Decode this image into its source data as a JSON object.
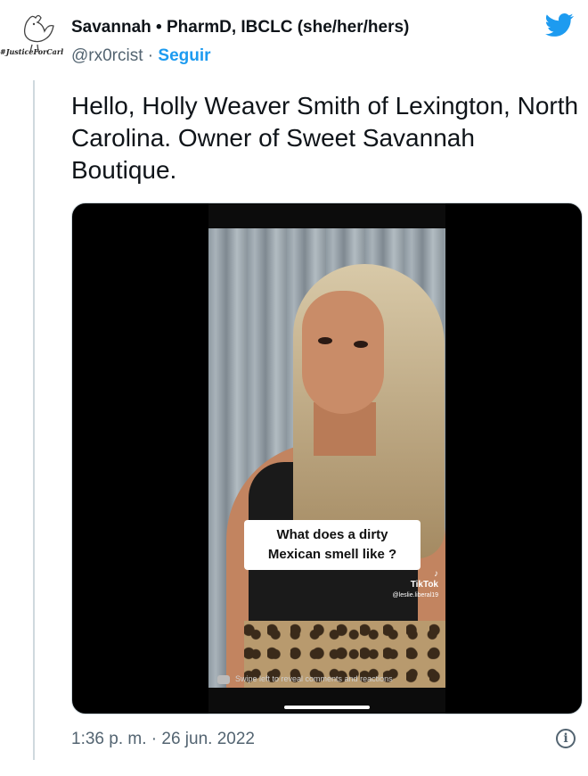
{
  "author": {
    "display_name": "Savannah • PharmD, IBCLC (she/her/hers)",
    "handle": "@rx0rcist",
    "separator": "·",
    "follow_label": "Seguir",
    "avatar_tag": "#JusticeForCarl",
    "avatar_icon": "rooster-icon"
  },
  "brand": {
    "icon": "twitter-bird-icon",
    "color": "#1d9bf0"
  },
  "tweet": {
    "text": "Hello, Holly Weaver Smith of Lexington, North Carolina. Owner of Sweet Savannah Boutique.",
    "timestamp": "1:36 p. m. · 26 jun. 2022"
  },
  "media": {
    "caption_line1": "What does a dirty",
    "caption_line2": "Mexican smell like ?",
    "watermark_brand": "TikTok",
    "watermark_handle": "@leslie.liberal19",
    "swipe_hint": "Swipe left to reveal comments and reactions"
  },
  "colors": {
    "accent": "#1d9bf0",
    "text": "#0f1419",
    "muted": "#536471",
    "border": "#cfd9de"
  }
}
